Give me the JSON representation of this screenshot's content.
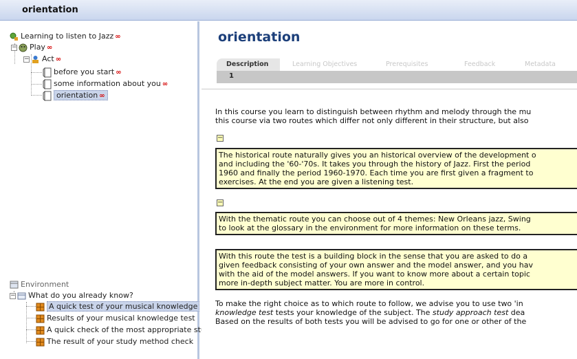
{
  "window": {
    "title": "orientation"
  },
  "tree": {
    "root": "Learning to listen to Jazz",
    "play": "Play",
    "act": "Act",
    "items": [
      "before you start",
      "some information about you",
      "orientation"
    ]
  },
  "environment": {
    "label": "Environment",
    "folder": "What do you already know?",
    "items": [
      "A quick test of your musical knowledge",
      "Results of your musical knowledge test",
      "A quick check of the most appropriate stu",
      "The result of your study method check"
    ]
  },
  "main": {
    "title": "orientation",
    "tabs": [
      "Description",
      "Learning Objectives",
      "Prerequisites",
      "Feedback",
      "Metadata"
    ],
    "tab_number": "1",
    "p1": [
      "In this course you learn to distinguish between rhythm and melody through the mu",
      "this course via two routes which differ not only different in their structure, but also"
    ],
    "box1": [
      "The historical route naturally gives you an historical overview of the development o",
      "and including the '60-'70s. It takes you through the history of Jazz. First the period",
      "1960 and finally the period 1960-1970. Each time you are first given a fragment to",
      "exercises. At the end you are given a listening test."
    ],
    "box2": [
      "With the thematic route you can choose out of 4 themes: New Orleans jazz, Swing",
      "to look at the glossary in the environment for more information on these terms."
    ],
    "box3": [
      "With this route the test is a building block in the sense that you are asked to do a",
      "given feedback consisting of your own answer and the model answer, and you hav",
      "with the aid of the model answers. If you want to know more about a certain topic",
      "more in-depth subject matter. You are more in control."
    ],
    "p2": {
      "l1": "To make the right choice as to which route to follow, we advise you to use two 'in",
      "l2a": "knowledge test",
      "l2b": " tests your knowledge of the subject. The ",
      "l2c": "study approach test",
      "l2d": " dea",
      "l3": "Based on the results of both tests you will be advised to go for one or other of the"
    }
  }
}
